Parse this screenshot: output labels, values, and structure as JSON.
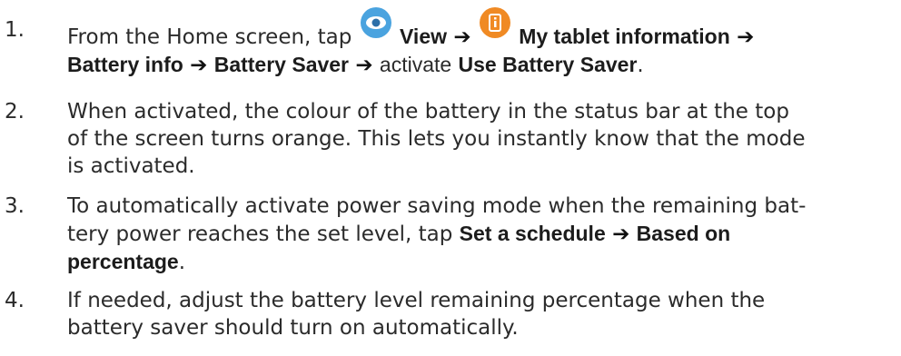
{
  "steps": [
    {
      "number": "1.",
      "parts": {
        "t1": "From the Home screen, tap",
        "b1": "View",
        "b2": "My tablet information",
        "b3": "Battery info",
        "b4": "Battery Saver",
        "t2": "activate",
        "b5": "Use Battery Saver",
        "end": "."
      },
      "icons": [
        "eye-icon",
        "info-icon"
      ],
      "arrow": "➔",
      "colors": {
        "view_icon": "#4aa3df",
        "info_icon": "#f08a24"
      }
    },
    {
      "number": "2.",
      "line1": "When activated, the colour of the battery in the status bar at the top",
      "line2": "of the screen turns orange. This lets you instantly know that the mode",
      "line3": "is activated."
    },
    {
      "number": "3.",
      "line1": "To automatically activate power saving mode when the remaining bat-",
      "line2_t": "tery power reaches the set level, tap",
      "b1": "Set a schedule",
      "b2": "Based on",
      "line3_b": "percentage",
      "end": "."
    },
    {
      "number": "4.",
      "line1": "If needed, adjust the battery level remaining percentage when the",
      "line2": "battery saver should turn on automatically."
    }
  ]
}
